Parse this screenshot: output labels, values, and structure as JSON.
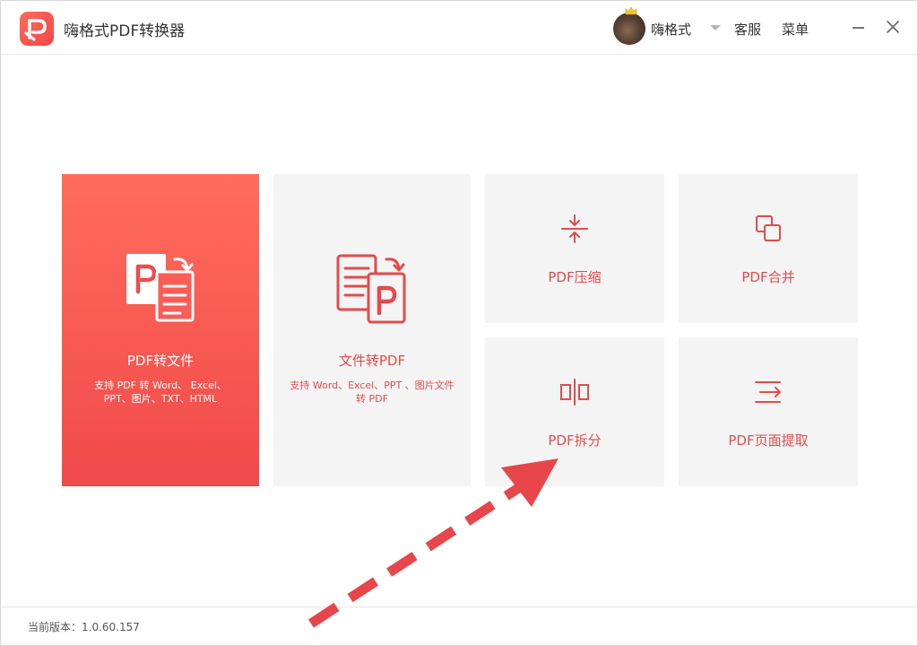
{
  "app": {
    "title": "嗨格式PDF转换器",
    "accent_color": "#f04a4a"
  },
  "header": {
    "username": "嗨格式",
    "service_label": "客服",
    "menu_label": "菜单",
    "icons": [
      "app-logo-icon",
      "avatar",
      "crown-icon",
      "chevron-down-icon",
      "minimize-icon",
      "close-icon"
    ]
  },
  "tiles": {
    "pdf_to_file": {
      "title": "PDF转文件",
      "desc": "支持 PDF 转 Word、 Excel、 PPT、图片、TXT、HTML"
    },
    "file_to_pdf": {
      "title": "文件转PDF",
      "desc": "支持 Word、Excel、PPT 、图片文件转 PDF"
    },
    "compress": {
      "title": "PDF压缩"
    },
    "merge": {
      "title": "PDF合并"
    },
    "split": {
      "title": "PDF拆分"
    },
    "extract": {
      "title": "PDF页面提取"
    }
  },
  "footer": {
    "version": "当前版本：1.0.60.157"
  }
}
